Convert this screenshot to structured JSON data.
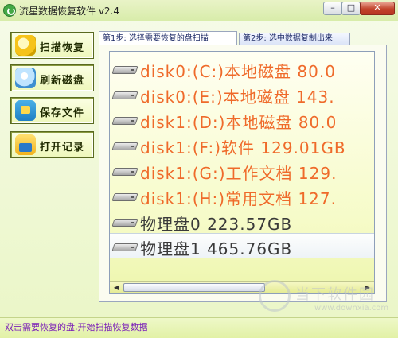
{
  "window": {
    "title": "流星数据恢复软件 v2.4",
    "buttons": {
      "minimize": "–",
      "maximize": "□",
      "close": "✕"
    }
  },
  "sidebar": {
    "items": [
      {
        "label": "扫描恢复",
        "icon": "scan-recover-icon"
      },
      {
        "label": "刷新磁盘",
        "icon": "refresh-disk-icon"
      },
      {
        "label": "保存文件",
        "icon": "save-file-icon"
      },
      {
        "label": "打开记录",
        "icon": "open-record-icon"
      }
    ]
  },
  "tabs": [
    {
      "label": "第1步: 选择需要恢复的盘扫描",
      "active": true
    },
    {
      "label": "第2步: 选中数据复制出来",
      "active": false
    }
  ],
  "disks": [
    {
      "label": "disk0:(C:)本地磁盘 80.0",
      "style": "orange"
    },
    {
      "label": "disk0:(E:)本地磁盘 143.",
      "style": "orange"
    },
    {
      "label": "disk1:(D:)本地磁盘 80.0",
      "style": "orange"
    },
    {
      "label": "disk1:(F:)软件 129.01GB",
      "style": "orange"
    },
    {
      "label": "disk1:(G:)工作文档 129.",
      "style": "orange"
    },
    {
      "label": "disk1:(H:)常用文档 127.",
      "style": "orange"
    },
    {
      "label": "物理盘0 223.57GB",
      "style": "dark"
    },
    {
      "label": "物理盘1 465.76GB",
      "style": "dark",
      "selected": true
    }
  ],
  "scrollbar": {
    "left_arrow": "◀",
    "right_arrow": "▶"
  },
  "status": {
    "text": "双击需要恢复的盘,开始扫描恢复数据"
  },
  "watermark": {
    "text": "当下软件园",
    "url": "www.downxia.com"
  },
  "colors": {
    "disk_text_orange": "#ef6a2a",
    "disk_text_dark": "#3a3a3a",
    "status_text": "#7a1fb8",
    "close_button": "#c2432b"
  }
}
